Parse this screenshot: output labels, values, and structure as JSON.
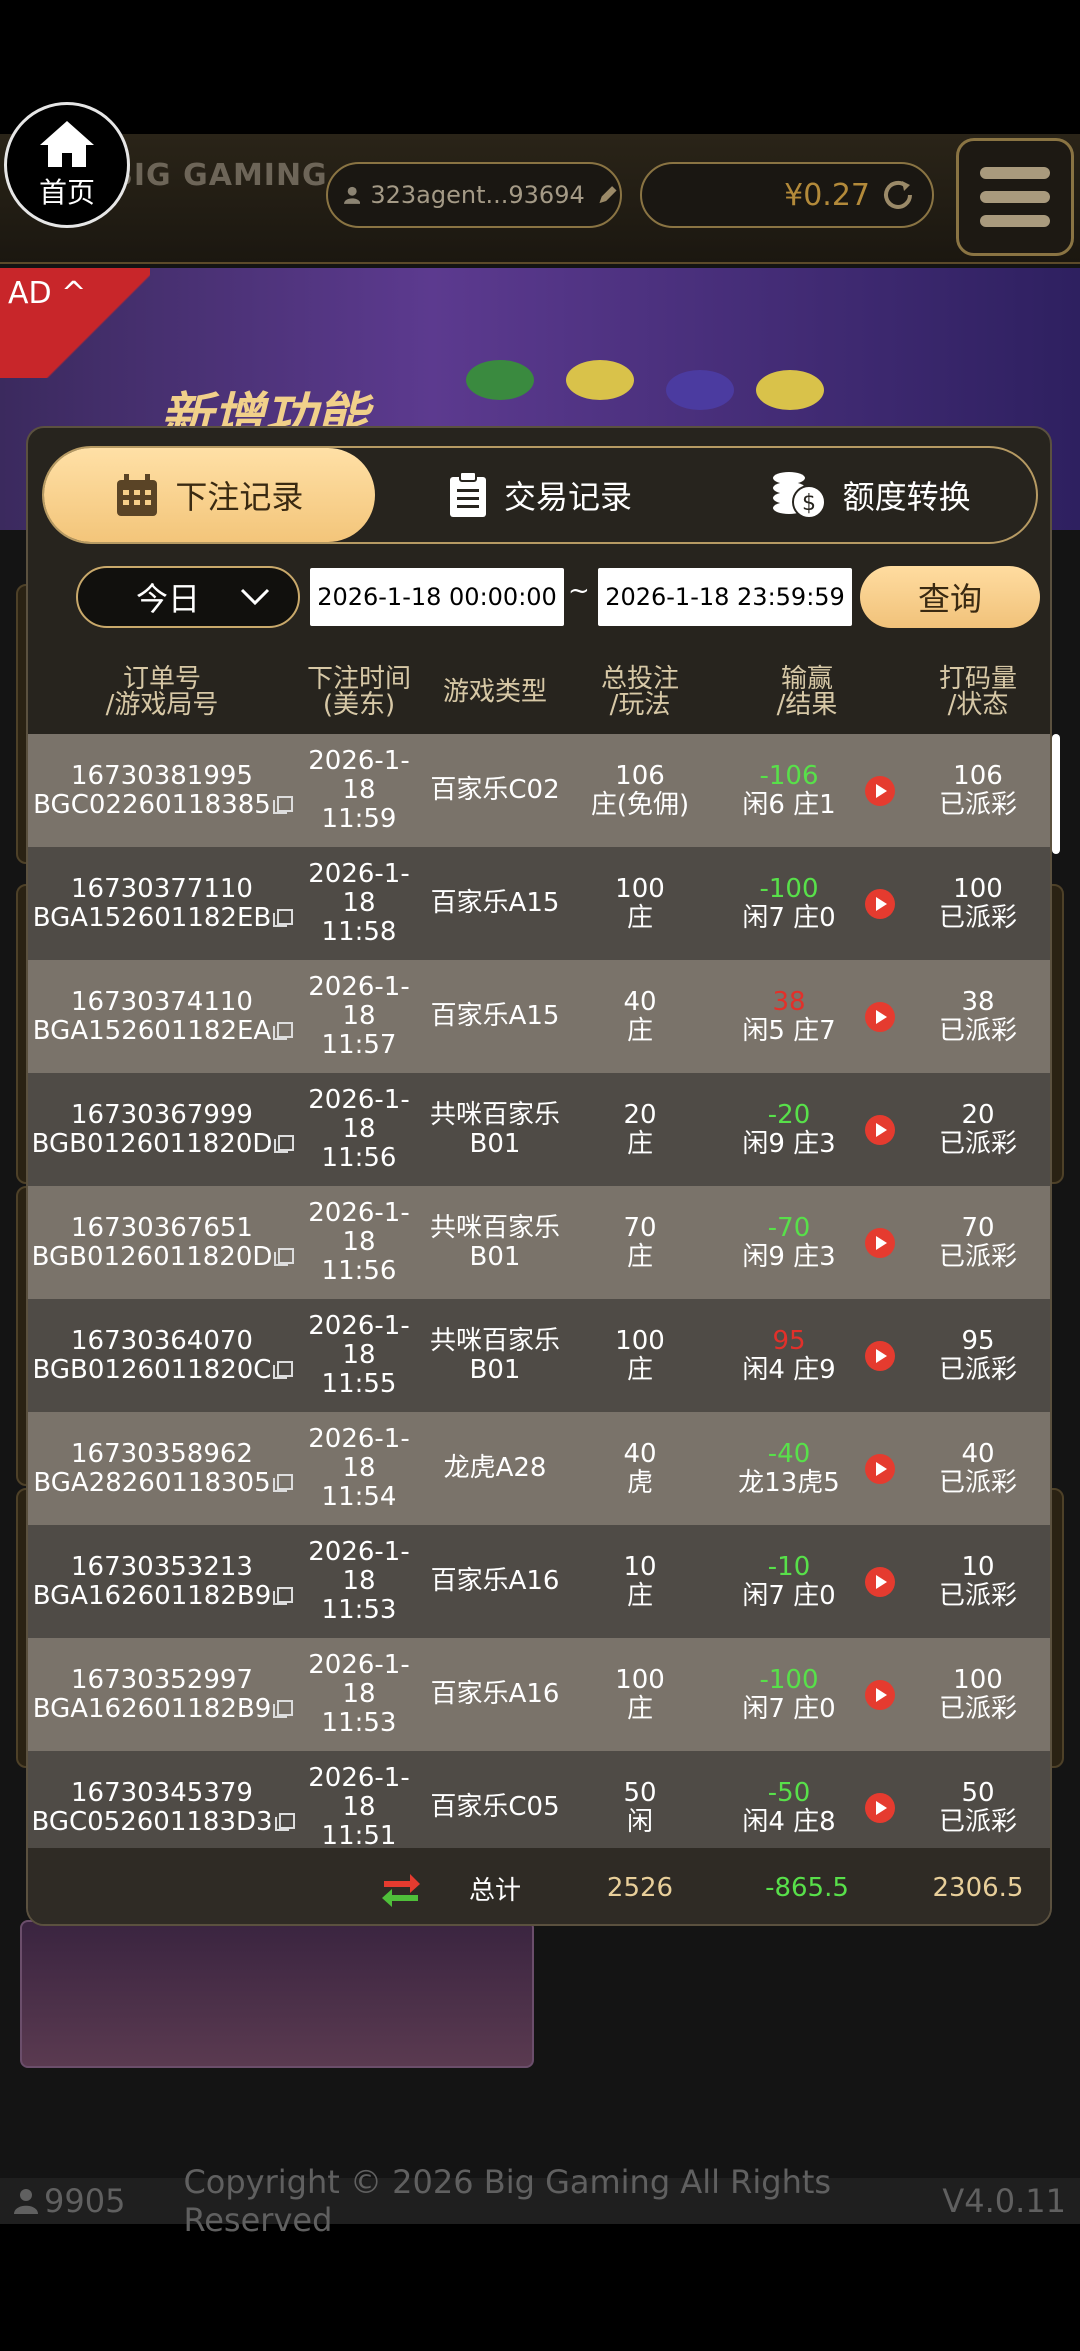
{
  "header": {
    "home_label": "首页",
    "logo_text": "BIG GAMING",
    "agent_name": "323agent...93694",
    "balance": "¥0.27"
  },
  "ad": {
    "tag": "AD",
    "banner_title": "新增功能"
  },
  "modal": {
    "tabs": [
      {
        "label": "下注记录",
        "icon": "calendar-icon",
        "active": true
      },
      {
        "label": "交易记录",
        "icon": "clipboard-icon",
        "active": false
      },
      {
        "label": "额度转换",
        "icon": "coins-icon",
        "active": false
      }
    ],
    "filter": {
      "period": "今日",
      "start": "2026-1-18 00:00:00",
      "separator": "~",
      "end": "2026-1-18 23:59:59",
      "query_label": "查询"
    },
    "columns": [
      {
        "line1": "订单号",
        "line2": "/游戏局号"
      },
      {
        "line1": "下注时间",
        "line2": "(美东)"
      },
      {
        "line1": "游戏类型",
        "line2": ""
      },
      {
        "line1": "总投注",
        "line2": "/玩法"
      },
      {
        "line1": "输赢",
        "line2": "/结果"
      },
      {
        "line1": "打码量",
        "line2": "/状态"
      }
    ],
    "rows": [
      {
        "order": "16730381995",
        "round": "BGC02260118385",
        "date": "2026-1-18",
        "time": "11:59",
        "game": "百家乐C02",
        "game2": "",
        "bet": "106",
        "play": "庄(免佣)",
        "win": "-106",
        "result": "闲6 庄1",
        "valid": "106",
        "status": "已派彩"
      },
      {
        "order": "16730377110",
        "round": "BGA152601182EB",
        "date": "2026-1-18",
        "time": "11:58",
        "game": "百家乐A15",
        "game2": "",
        "bet": "100",
        "play": "庄",
        "win": "-100",
        "result": "闲7 庄0",
        "valid": "100",
        "status": "已派彩"
      },
      {
        "order": "16730374110",
        "round": "BGA152601182EA",
        "date": "2026-1-18",
        "time": "11:57",
        "game": "百家乐A15",
        "game2": "",
        "bet": "40",
        "play": "庄",
        "win": "38",
        "result": "闲5 庄7",
        "valid": "38",
        "status": "已派彩"
      },
      {
        "order": "16730367999",
        "round": "BGB0126011820D",
        "date": "2026-1-18",
        "time": "11:56",
        "game": "共咪百家乐",
        "game2": "B01",
        "bet": "20",
        "play": "庄",
        "win": "-20",
        "result": "闲9 庄3",
        "valid": "20",
        "status": "已派彩"
      },
      {
        "order": "16730367651",
        "round": "BGB0126011820D",
        "date": "2026-1-18",
        "time": "11:56",
        "game": "共咪百家乐",
        "game2": "B01",
        "bet": "70",
        "play": "庄",
        "win": "-70",
        "result": "闲9 庄3",
        "valid": "70",
        "status": "已派彩"
      },
      {
        "order": "16730364070",
        "round": "BGB0126011820C",
        "date": "2026-1-18",
        "time": "11:55",
        "game": "共咪百家乐",
        "game2": "B01",
        "bet": "100",
        "play": "庄",
        "win": "95",
        "result": "闲4 庄9",
        "valid": "95",
        "status": "已派彩"
      },
      {
        "order": "16730358962",
        "round": "BGA28260118305",
        "date": "2026-1-18",
        "time": "11:54",
        "game": "龙虎A28",
        "game2": "",
        "bet": "40",
        "play": "虎",
        "win": "-40",
        "result": "龙13虎5",
        "valid": "40",
        "status": "已派彩"
      },
      {
        "order": "16730353213",
        "round": "BGA162601182B9",
        "date": "2026-1-18",
        "time": "11:53",
        "game": "百家乐A16",
        "game2": "",
        "bet": "10",
        "play": "庄",
        "win": "-10",
        "result": "闲7 庄0",
        "valid": "10",
        "status": "已派彩"
      },
      {
        "order": "16730352997",
        "round": "BGA162601182B9",
        "date": "2026-1-18",
        "time": "11:53",
        "game": "百家乐A16",
        "game2": "",
        "bet": "100",
        "play": "庄",
        "win": "-100",
        "result": "闲7 庄0",
        "valid": "100",
        "status": "已派彩"
      },
      {
        "order": "16730345379",
        "round": "BGC052601183D3",
        "date": "2026-1-18",
        "time": "11:51",
        "game": "百家乐C05",
        "game2": "",
        "bet": "50",
        "play": "闲",
        "win": "-50",
        "result": "闲4 庄8",
        "valid": "50",
        "status": "已派彩"
      }
    ],
    "totals": {
      "label": "总计",
      "bet": "2526",
      "win": "-865.5",
      "valid": "2306.5"
    }
  },
  "footer": {
    "online": "9905",
    "copyright": "Copyright © 2026 Big Gaming All Rights Reserved",
    "version": "V4.0.11"
  },
  "colors": {
    "win_negative": "#58e04a",
    "win_positive": "#e2302a",
    "accent_gold": "#f3c57a"
  }
}
